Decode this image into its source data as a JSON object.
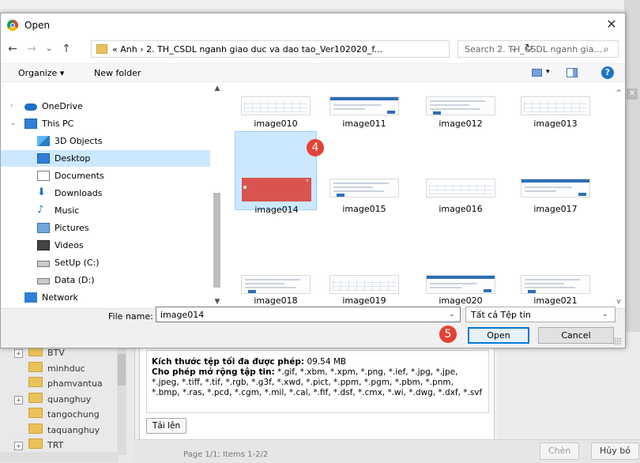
{
  "dialog": {
    "title": "Open",
    "close_glyph": "✕",
    "nav": {
      "back": "←",
      "forward": "→",
      "recent": "⌄",
      "up": "↑"
    },
    "address_path": "« Anh › 2. TH_CSDL nganh giao duc va dao tao_Ver102020_f...",
    "address_dropdown": "⌄",
    "refresh_glyph": "↻",
    "search_placeholder": "Search 2. TH_CSDL nganh gia...",
    "search_glyph": "⌕",
    "toolbar": {
      "organize": "Organize ▾",
      "new_folder": "New folder",
      "help": "?"
    },
    "sidebar": [
      {
        "label": "OneDrive",
        "icon": "cloud-icon",
        "expander": "›"
      },
      {
        "label": "This PC",
        "icon": "computer-icon",
        "expander": "⌄"
      },
      {
        "label": "3D Objects",
        "icon": "cube-icon"
      },
      {
        "label": "Desktop",
        "icon": "desktop-icon"
      },
      {
        "label": "Documents",
        "icon": "document-icon"
      },
      {
        "label": "Downloads",
        "icon": "download-icon"
      },
      {
        "label": "Music",
        "icon": "music-icon"
      },
      {
        "label": "Pictures",
        "icon": "pictures-icon"
      },
      {
        "label": "Videos",
        "icon": "video-icon"
      },
      {
        "label": "SetUp (C:)",
        "icon": "drive-icon"
      },
      {
        "label": "Data (D:)",
        "icon": "drive-icon"
      },
      {
        "label": "Network",
        "icon": "network-icon"
      }
    ],
    "files": [
      {
        "name": "image010"
      },
      {
        "name": "image011"
      },
      {
        "name": "image012"
      },
      {
        "name": "image013"
      },
      {
        "name": "image014"
      },
      {
        "name": "image015"
      },
      {
        "name": "image016"
      },
      {
        "name": "image017"
      },
      {
        "name": "image018"
      },
      {
        "name": "image019"
      },
      {
        "name": "image020"
      },
      {
        "name": "image021"
      }
    ],
    "selected_file": "image014",
    "file_name_label": "File name:",
    "file_name_value": "image014",
    "file_type_value": "Tất cả Tệp tin",
    "open_label": "Open",
    "cancel_label": "Cancel"
  },
  "annotations": {
    "step_4": "4",
    "step_5": "5"
  },
  "background": {
    "tree": [
      {
        "label": "BTV",
        "expander": "+"
      },
      {
        "label": "minhduc"
      },
      {
        "label": "phamvantua"
      },
      {
        "label": "quanghuy",
        "expander": "+"
      },
      {
        "label": "tangochung"
      },
      {
        "label": "taquanghuy"
      },
      {
        "label": "TRT",
        "expander": "+"
      }
    ],
    "max_size_label": "Kích thước tệp tối đa được phép:",
    "max_size_value": "09.54 MB",
    "ext_label": "Cho phép mở rộng tập tin:",
    "ext_value": "*.gif, *.xbm, *.xpm, *.png, *.ief, *.jpg, *.jpe, *.jpeg, *.tiff, *.tif, *.rgb, *.g3f, *.xwd, *.pict, *.ppm, *.pgm, *.pbm, *.pnm, *.bmp, *.ras, *.pcd, *.cgm, *.mil, *.cal, *.fif, *.dsf, *.cmx, *.wi, *.dwg, *.dxf, *.svf",
    "upload_label": "Tải lên",
    "pager": "Page 1/1; Items 1-2/2",
    "choose_label": "Chèn",
    "cancel_label": "Hủy bỏ"
  },
  "colors": {
    "selection": "#cce8ff",
    "accent": "#0078d7",
    "badge": "#e34234"
  }
}
